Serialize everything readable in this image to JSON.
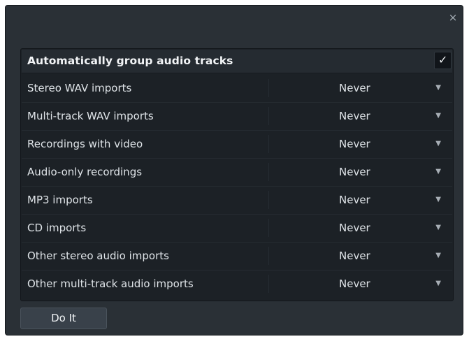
{
  "dialog": {
    "close_icon": "×",
    "group": {
      "title": "Automatically group audio tracks",
      "checked": true,
      "check_glyph": "✓"
    },
    "rows": [
      {
        "label": "Stereo WAV imports",
        "value": "Never"
      },
      {
        "label": "Multi-track WAV imports",
        "value": "Never"
      },
      {
        "label": "Recordings with video",
        "value": "Never"
      },
      {
        "label": "Audio-only recordings",
        "value": "Never"
      },
      {
        "label": "MP3 imports",
        "value": "Never"
      },
      {
        "label": "CD imports",
        "value": "Never"
      },
      {
        "label": "Other stereo audio imports",
        "value": "Never"
      },
      {
        "label": "Other multi-track audio imports",
        "value": "Never"
      }
    ],
    "dropdown_arrow": "▼",
    "do_it_label": "Do It"
  },
  "colors": {
    "dialog_bg": "#2a3036",
    "panel_bg": "#1c2126",
    "header_bg": "#252b31",
    "text": "#dfe4e8",
    "button_bg": "#39414a"
  }
}
